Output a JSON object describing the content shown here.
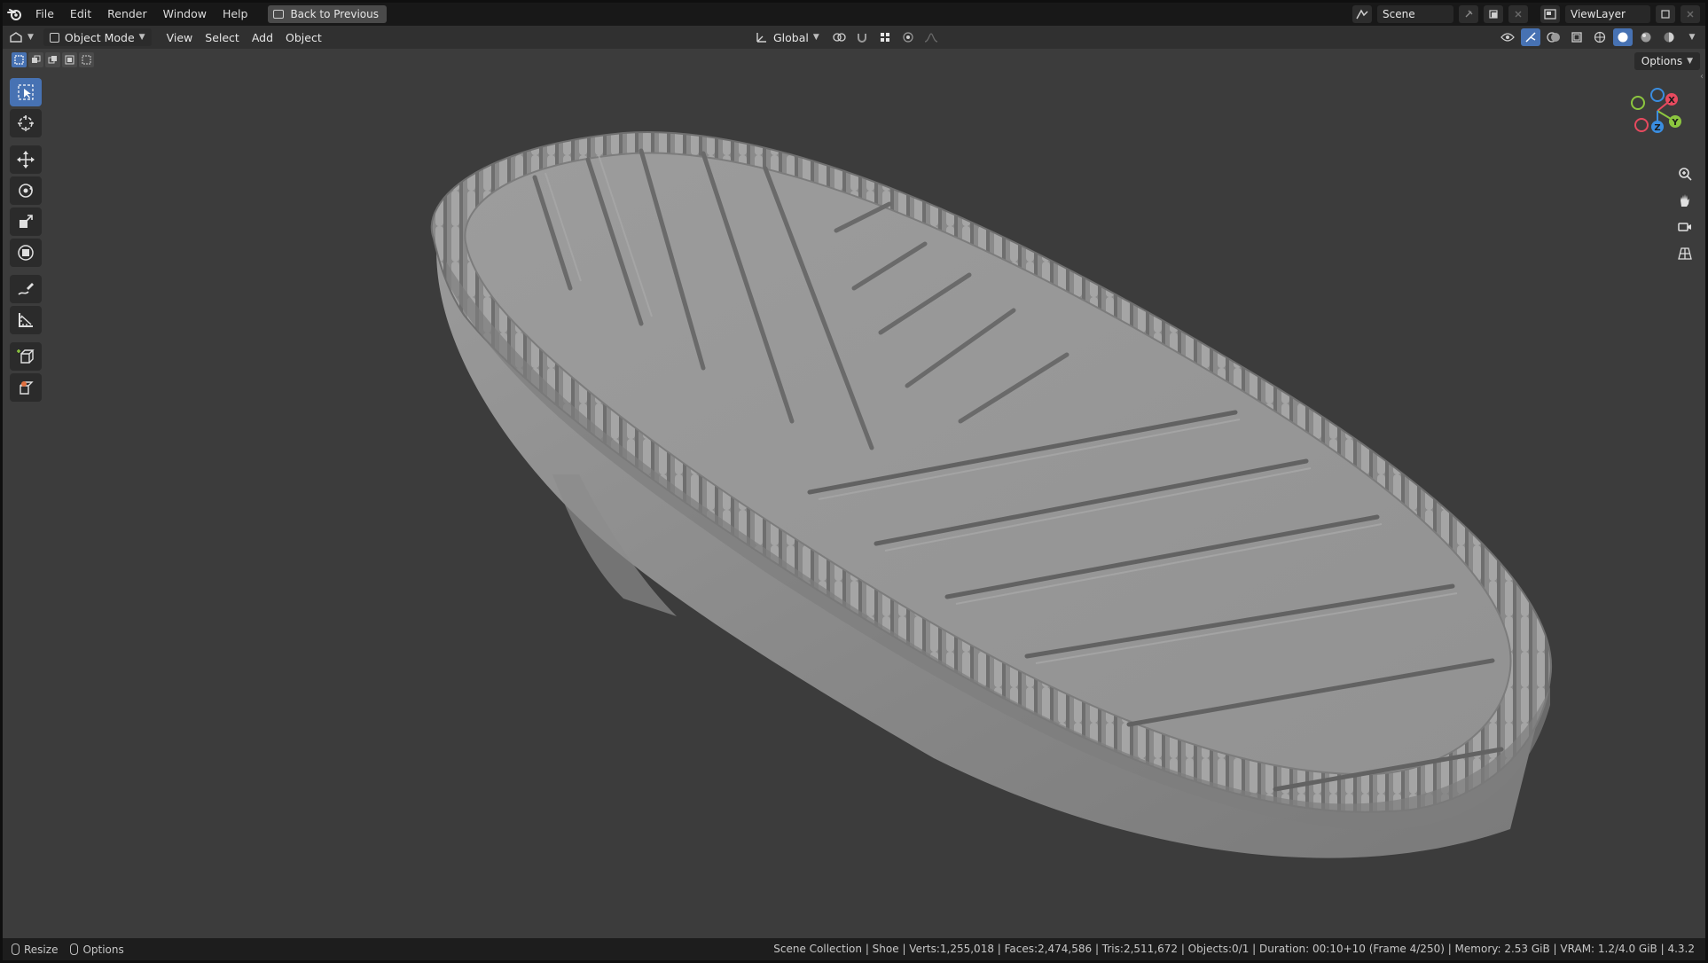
{
  "menu": {
    "items": [
      "File",
      "Edit",
      "Render",
      "Window",
      "Help"
    ],
    "back_button": "Back to Previous"
  },
  "top_right": {
    "scene_name": "Scene",
    "view_layer": "ViewLayer"
  },
  "viewport_header": {
    "mode": "Object Mode",
    "menus": [
      "View",
      "Select",
      "Add",
      "Object"
    ],
    "transform_orientation": "Global"
  },
  "viewport": {
    "options_label": "Options",
    "gizmo_axes": {
      "x": "X",
      "y": "Y",
      "z": "Z"
    },
    "axis_colors": {
      "x": "#e84a5f",
      "y": "#8cc63f",
      "z": "#3a8de0"
    },
    "object_color": "#8f8f8f"
  },
  "statusbar": {
    "left": [
      "Resize",
      "Options"
    ],
    "info": "Scene Collection | Shoe | Verts:1,255,018 | Faces:2,474,586 | Tris:2,511,672 | Objects:0/1 | Duration: 00:10+10 (Frame 4/250) | Memory: 2.53 GiB | VRAM: 1.2/4.0 GiB | 4.3.2"
  },
  "colors": {
    "accent": "#4772b3",
    "topbar_bg": "#181818",
    "header_bg": "#303030",
    "viewport_bg": "#3c3c3c"
  }
}
